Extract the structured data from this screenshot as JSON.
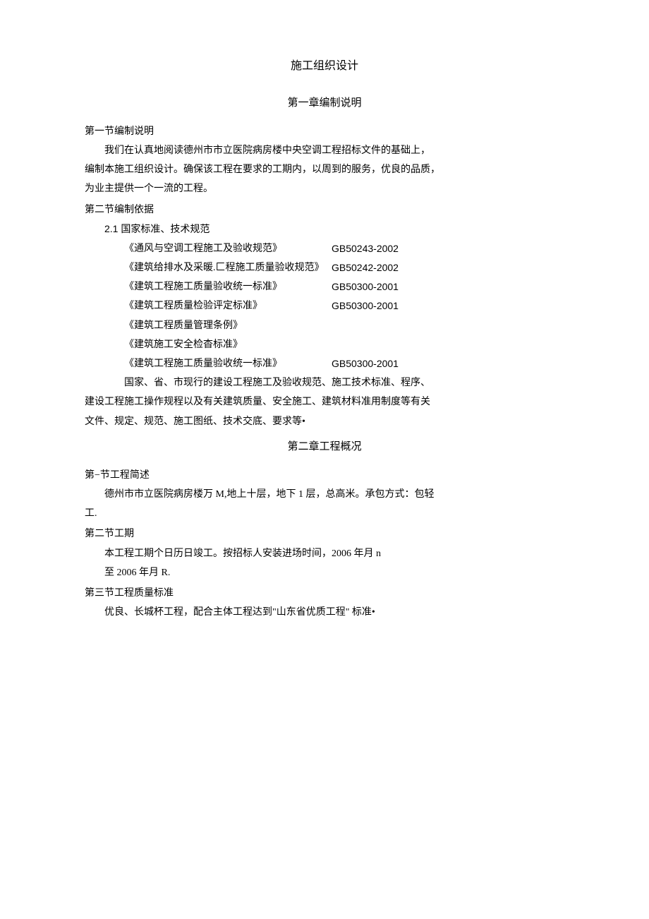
{
  "title": "施工组织设计",
  "chapter1": {
    "heading": "第一章编制说明",
    "section1": {
      "heading": "第一节编制说明",
      "p1": "我们在认真地阅读德州市市立医院病房楼中央空调工程招标文件的基础上，",
      "p2": "编制本施工组织设计。确保该工程在要求的工期内，以周到的服务，优良的品质，",
      "p3": "为业主提供一个一流的工程。"
    },
    "section2": {
      "heading": "第二节编制依据",
      "sub21": "2.1 国家标准、技术规范",
      "standards": [
        {
          "name": "《通风与空调工程施工及验收规范》",
          "code": "GB50243-2002"
        },
        {
          "name": "《建筑给排水及采暖.匚程施工质量验收规范》",
          "code": "GB50242-2002"
        },
        {
          "name": "《建筑工程施工质量验收统一标准》",
          "code": "GB50300-2001"
        },
        {
          "name": "《建筑工程质量检验评定标准》",
          "code": "GB50300-2001"
        },
        {
          "name": "《建筑工程质量管理条例》",
          "code": ""
        },
        {
          "name": "《建筑施工安全检杳标准》",
          "code": ""
        },
        {
          "name": "《建筑工程施工质量验收统一标准》",
          "code": "GB50300-2001"
        }
      ],
      "tail1": "国家、省、市现行的建设工程施工及验收规范、施工技术标准、程序、",
      "tail2": "建设工程施工操作规程以及有关建筑质量、安全施工、建筑材料准用制度等有关",
      "tail3": "文件、规定、规范、施工图纸、技术交底、要求等•"
    }
  },
  "chapter2": {
    "heading": "第二章工程概况",
    "section1": {
      "heading": "第−节工程简述",
      "p1": "德州市市立医院病房楼万 M,地上十层，地下 1 层，总高米。承包方式：包轻",
      "p2": "工."
    },
    "section2": {
      "heading": "第二节工期",
      "p1": "本工程工期个日历日竣工。按招标人安装进场时间，2006 年月 n",
      "p2": "至 2006 年月 R."
    },
    "section3": {
      "heading": "第三节工程质量标准",
      "p1": "优良、长城杯工程，配合主体工程达到\"山东省优质工程\" 标准•"
    }
  }
}
